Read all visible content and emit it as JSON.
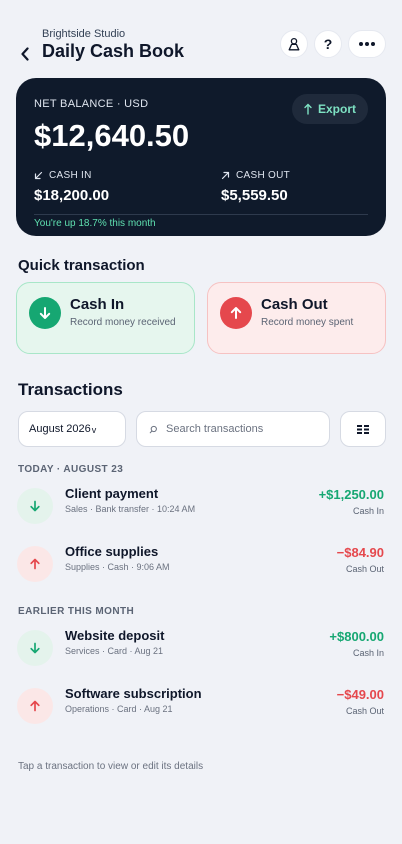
{
  "header": {
    "subtitle": "Brightside Studio",
    "title": "Daily Cash Book",
    "back_icon": "chevron-left-icon",
    "user_icon": "user-icon",
    "help_label": "?",
    "more_icon": "more-horizontal-icon"
  },
  "balance": {
    "label": "NET BALANCE · USD",
    "amount": "$12,640.50",
    "export_label": "Export",
    "cash_in_label": "CASH IN",
    "cash_in_value": "$18,200.00",
    "cash_out_label": "CASH OUT",
    "cash_out_value": "$5,559.50",
    "note": "You're up 18.7% this month"
  },
  "quick": {
    "title": "Quick transaction",
    "cash_in": {
      "title": "Cash In",
      "subtitle": "Record money received"
    },
    "cash_out": {
      "title": "Cash Out",
      "subtitle": "Record money spent"
    }
  },
  "transactions": {
    "title": "Transactions",
    "month": "August 2026",
    "search_placeholder": "Search transactions",
    "groups": [
      {
        "label": "TODAY · AUGUST 23",
        "items": [
          {
            "name": "Client payment",
            "meta": "Sales · Bank transfer · 10:24 AM",
            "amount": "+$1,250.00",
            "type": "Cash In",
            "direction": "in"
          },
          {
            "name": "Office supplies",
            "meta": "Supplies · Cash · 9:06 AM",
            "amount": "−$84.90",
            "type": "Cash Out",
            "direction": "out"
          }
        ]
      },
      {
        "label": "EARLIER THIS MONTH",
        "items": [
          {
            "name": "Website deposit",
            "meta": "Services · Card · Aug 21",
            "amount": "+$800.00",
            "type": "Cash In",
            "direction": "in"
          },
          {
            "name": "Software subscription",
            "meta": "Operations · Card · Aug 21",
            "amount": "−$49.00",
            "type": "Cash Out",
            "direction": "out"
          }
        ]
      }
    ]
  },
  "footer_hint": "Tap a transaction to view or edit its details",
  "colors": {
    "card_bg": "#0f1a2b",
    "accent_green": "#16a772",
    "accent_red": "#e5484d",
    "export_text": "#7ee2c3"
  }
}
